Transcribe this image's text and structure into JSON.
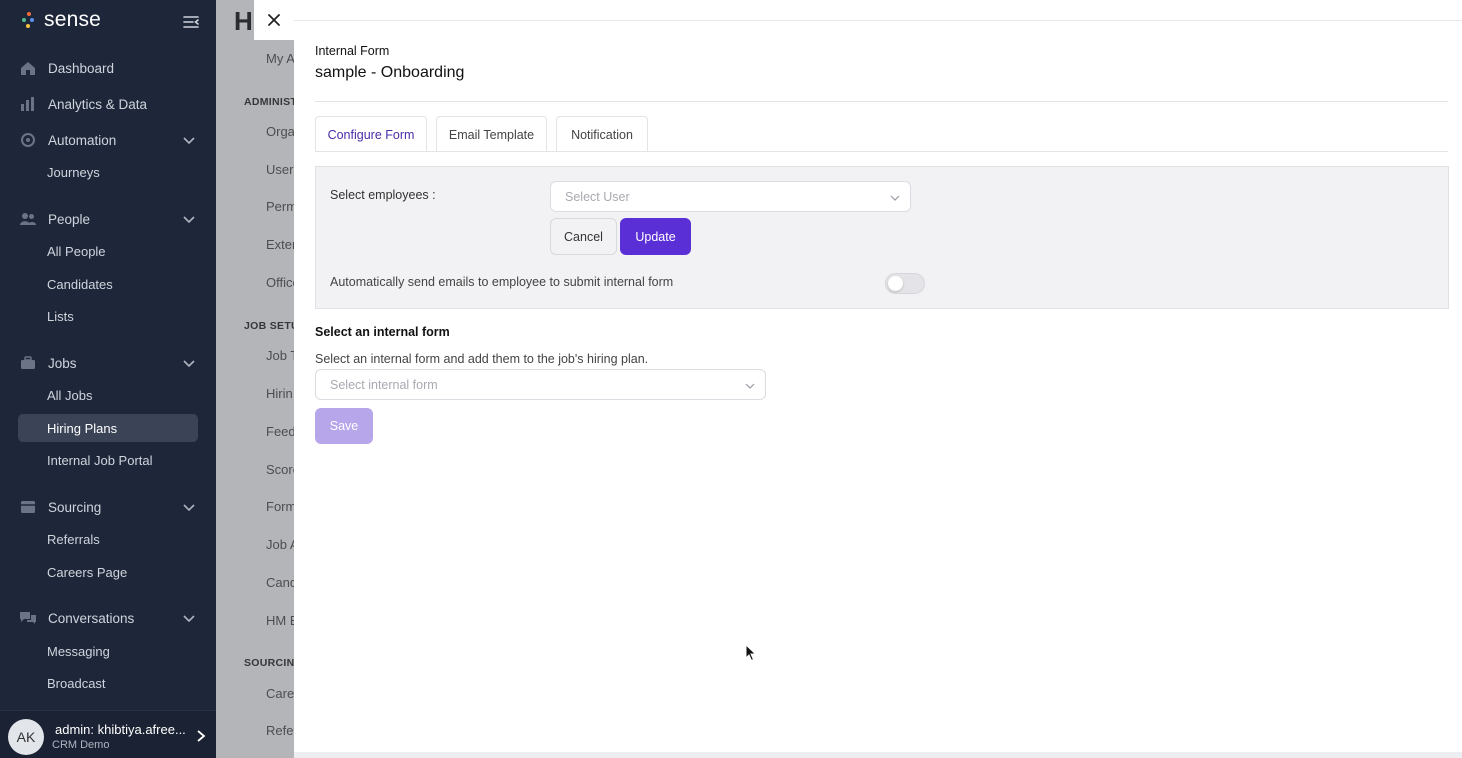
{
  "app": {
    "brand": "sense"
  },
  "sidebar": {
    "items": [
      {
        "label": "Dashboard",
        "icon": "home-icon"
      },
      {
        "label": "Analytics & Data",
        "icon": "bar-chart-icon"
      },
      {
        "label": "Automation",
        "icon": "automation-icon",
        "sub": [
          "Journeys"
        ]
      },
      {
        "label": "People",
        "icon": "people-icon",
        "sub": [
          "All People",
          "Candidates",
          "Lists"
        ]
      },
      {
        "label": "Jobs",
        "icon": "briefcase-icon",
        "sub": [
          "All Jobs",
          "Hiring Plans",
          "Internal Job Portal"
        ]
      },
      {
        "label": "Sourcing",
        "icon": "sourcing-icon",
        "sub": [
          "Referrals",
          "Careers Page"
        ]
      },
      {
        "label": "Conversations",
        "icon": "chat-icon",
        "sub": [
          "Messaging",
          "Broadcast"
        ]
      }
    ],
    "active_sub": "Hiring Plans",
    "user": {
      "initials": "AK",
      "name": "admin: khibtiya.afree...",
      "org": "CRM Demo"
    }
  },
  "background_page": {
    "title": "Hi",
    "sections": [
      {
        "heading": "",
        "links": [
          "My A"
        ]
      },
      {
        "heading": "ADMINIST",
        "links": [
          "Orga",
          "Users",
          "Perm",
          "Exter",
          "Office"
        ]
      },
      {
        "heading": "JOB SETU",
        "links": [
          "Job T",
          "Hirin",
          "Feed",
          "Score",
          "Form",
          "Job A",
          "Cand",
          "HM E"
        ]
      },
      {
        "heading": "SOURCING",
        "links": [
          "Care",
          "Refer"
        ]
      }
    ]
  },
  "modal": {
    "label": "Internal Form",
    "title": "sample - Onboarding",
    "tabs": [
      "Configure Form",
      "Email Template",
      "Notification"
    ],
    "active_tab": "Configure Form",
    "config": {
      "employees_label": "Select employees :",
      "user_select_placeholder": "Select User",
      "cancel_label": "Cancel",
      "update_label": "Update",
      "auto_email_label": "Automatically send emails to employee to submit internal form",
      "auto_email_enabled": false
    },
    "internal_form": {
      "section_title": "Select an internal form",
      "description": "Select an internal form and add them to the job's hiring plan.",
      "select_placeholder": "Select internal form",
      "save_label": "Save"
    }
  },
  "colors": {
    "sidebar_bg": "#1e2739",
    "accent": "#5b2fd6",
    "accent_disabled": "#b7a6ea",
    "active_tab_text": "#4b2ca8"
  }
}
